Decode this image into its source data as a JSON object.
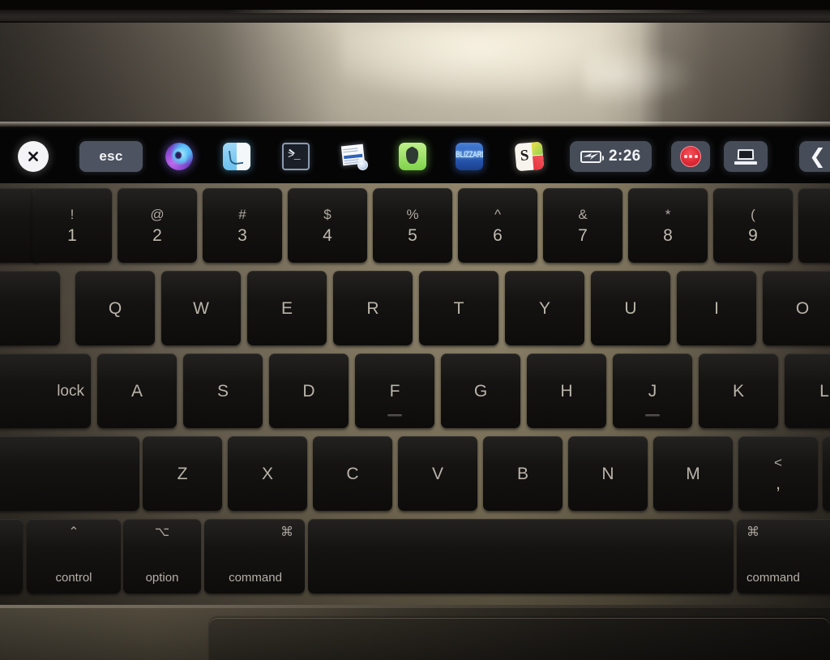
{
  "device": {
    "name": "MacBook Pro with Touch Bar",
    "accent_colors": {
      "touchbar_background": "#050505",
      "esc_pill": "#4d5360",
      "status_pill": "#464c58",
      "record_red": "#e02a36",
      "key_cap": "#141312",
      "key_legend": "#b9b3a9",
      "aluminum": "#8d8165"
    }
  },
  "touchbar": {
    "close_button": {
      "name": "close-touchbar",
      "glyph": "✕"
    },
    "esc_key": {
      "label": "esc"
    },
    "app_icons": [
      {
        "name": "firefox-icon",
        "label": "Firefox"
      },
      {
        "name": "finder-icon",
        "label": "Finder"
      },
      {
        "name": "terminal-icon",
        "label": "Terminal",
        "glyph": ">_"
      },
      {
        "name": "preview-icon",
        "label": "Preview"
      },
      {
        "name": "evernote-icon",
        "label": "Evernote"
      },
      {
        "name": "blizzard-icon",
        "label": "BLIZZARD"
      },
      {
        "name": "snapchat-icon",
        "label": "S"
      }
    ],
    "status_items": [
      {
        "name": "battery-time-pill",
        "icon": "battery-charging-icon",
        "value": "2:26"
      },
      {
        "name": "record-pill",
        "icon": "record-stop-icon"
      },
      {
        "name": "display-pill",
        "icon": "laptop-icon"
      },
      {
        "name": "expand-control-strip",
        "icon": "chevron-left-icon",
        "glyph": "❮"
      }
    ]
  },
  "keyboard": {
    "number_row": [
      {
        "top": "",
        "bottom": "",
        "name": "key-tilde-partial"
      },
      {
        "top": "!",
        "bottom": "1",
        "name": "key-1"
      },
      {
        "top": "@",
        "bottom": "2",
        "name": "key-2"
      },
      {
        "top": "#",
        "bottom": "3",
        "name": "key-3"
      },
      {
        "top": "$",
        "bottom": "4",
        "name": "key-4"
      },
      {
        "top": "%",
        "bottom": "5",
        "name": "key-5"
      },
      {
        "top": "^",
        "bottom": "6",
        "name": "key-6"
      },
      {
        "top": "&",
        "bottom": "7",
        "name": "key-7"
      },
      {
        "top": "*",
        "bottom": "8",
        "name": "key-8"
      },
      {
        "top": "(",
        "bottom": "9",
        "name": "key-9"
      },
      {
        "top": "",
        "bottom": "",
        "name": "key-0-partial"
      }
    ],
    "top_letter_row": [
      {
        "label": "",
        "name": "key-tab-partial"
      },
      {
        "label": "Q",
        "name": "key-q"
      },
      {
        "label": "W",
        "name": "key-w"
      },
      {
        "label": "E",
        "name": "key-e"
      },
      {
        "label": "R",
        "name": "key-r"
      },
      {
        "label": "T",
        "name": "key-t"
      },
      {
        "label": "Y",
        "name": "key-y"
      },
      {
        "label": "U",
        "name": "key-u"
      },
      {
        "label": "I",
        "name": "key-i"
      },
      {
        "label": "O",
        "name": "key-o"
      }
    ],
    "home_letter_row": [
      {
        "label": "lock",
        "name": "key-caps-lock"
      },
      {
        "label": "A",
        "name": "key-a"
      },
      {
        "label": "S",
        "name": "key-s"
      },
      {
        "label": "D",
        "name": "key-d"
      },
      {
        "label": "F",
        "name": "key-f",
        "home_ridge": true
      },
      {
        "label": "G",
        "name": "key-g"
      },
      {
        "label": "H",
        "name": "key-h"
      },
      {
        "label": "J",
        "name": "key-j",
        "home_ridge": true
      },
      {
        "label": "K",
        "name": "key-k"
      },
      {
        "label": "L",
        "name": "key-l"
      }
    ],
    "bottom_letter_row": [
      {
        "label": "",
        "name": "key-shift-left"
      },
      {
        "label": "Z",
        "name": "key-z"
      },
      {
        "label": "X",
        "name": "key-x"
      },
      {
        "label": "C",
        "name": "key-c"
      },
      {
        "label": "V",
        "name": "key-v"
      },
      {
        "label": "B",
        "name": "key-b"
      },
      {
        "label": "N",
        "name": "key-n"
      },
      {
        "label": "M",
        "name": "key-m"
      },
      {
        "top": "<",
        "bottom": ",",
        "name": "key-comma"
      }
    ],
    "modifier_row": [
      {
        "symbol": "",
        "word": "",
        "name": "key-fn-partial"
      },
      {
        "symbol": "⌃",
        "word": "control",
        "name": "key-control"
      },
      {
        "symbol": "⌥",
        "word": "option",
        "name": "key-option"
      },
      {
        "symbol": "⌘",
        "word": "command",
        "name": "key-command-left"
      },
      {
        "symbol": "",
        "word": "",
        "name": "key-space"
      },
      {
        "symbol": "⌘",
        "word": "command",
        "name": "key-command-right"
      }
    ]
  },
  "trackpad": {
    "name": "trackpad"
  }
}
